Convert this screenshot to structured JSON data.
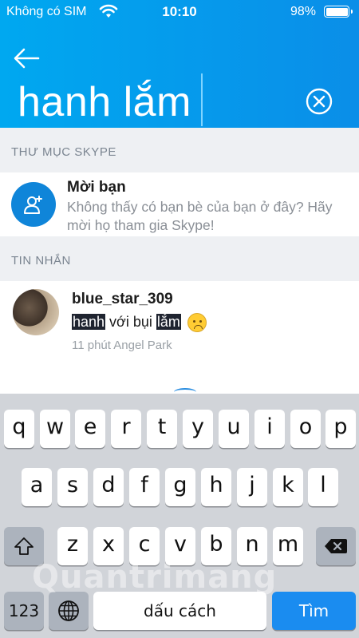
{
  "status_bar": {
    "carrier": "Không có SIM",
    "time": "10:10",
    "battery": "98%"
  },
  "search": {
    "query": "hanh lắm"
  },
  "sections": {
    "directory": "THƯ MỤC SKYPE",
    "messages": "TIN NHẮN"
  },
  "invite": {
    "title": "Mời bạn",
    "description": "Không thấy có bạn bè của bạn ở đây? Hãy mời họ tham gia Skype!"
  },
  "message_result": {
    "name": "blue_star_309",
    "snippet_hl1": "hanh",
    "snippet_mid": " với bụi ",
    "snippet_hl2": "lắm",
    "meta": "11 phút Angel Park"
  },
  "keyboard": {
    "row1": [
      "q",
      "w",
      "e",
      "r",
      "t",
      "y",
      "u",
      "i",
      "o",
      "p"
    ],
    "row2": [
      "a",
      "s",
      "d",
      "f",
      "g",
      "h",
      "j",
      "k",
      "l"
    ],
    "row3": [
      "z",
      "x",
      "c",
      "v",
      "b",
      "n",
      "m"
    ],
    "numbers_key": "123",
    "space_key": "dấu cách",
    "search_key": "Tìm"
  },
  "watermark": "Quantrimang",
  "colors": {
    "header": "#0a9aeb",
    "accent": "#0f85d9",
    "search_key": "#1a8cf0"
  }
}
